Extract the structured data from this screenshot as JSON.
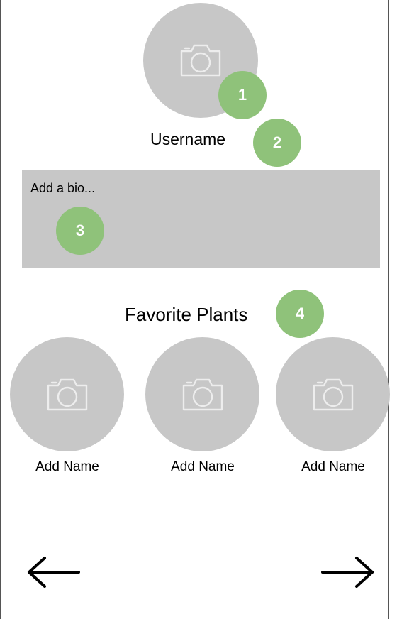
{
  "colors": {
    "placeholder_gray": "#c7c7c7",
    "badge_green": "#8fc27a",
    "camera_stroke": "#ededed",
    "text": "#000000"
  },
  "profile": {
    "photo_icon": "camera-icon",
    "username": "Username",
    "bio_placeholder": "Add a bio..."
  },
  "favorites": {
    "title": "Favorite Plants",
    "plants": [
      {
        "icon": "camera-icon",
        "name": "Add Name"
      },
      {
        "icon": "camera-icon",
        "name": "Add Name"
      },
      {
        "icon": "camera-icon",
        "name": "Add Name"
      }
    ]
  },
  "badges": [
    "1",
    "2",
    "3",
    "4"
  ],
  "navigation": {
    "back_icon": "arrow-left-icon",
    "forward_icon": "arrow-right-icon"
  }
}
